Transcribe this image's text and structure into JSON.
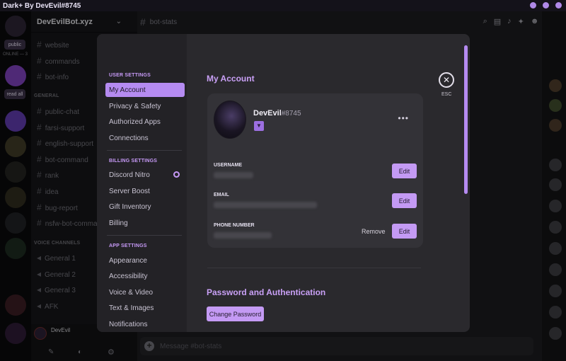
{
  "titlebar": {
    "title": "Dark+ By DevEvil#8745"
  },
  "rail": {
    "pill_public": "public",
    "online_label": "ONLINE — 3",
    "pill_read_all": "read all"
  },
  "guild": {
    "name": "DevEvilBot.xyz"
  },
  "channels": {
    "top": [
      "website",
      "commands",
      "bot-info"
    ],
    "general_header": "GENERAL",
    "general": [
      "public-chat",
      "farsi-support",
      "english-support",
      "bot-command",
      "rank",
      "idea",
      "bug-report",
      "nsfw-bot-command"
    ],
    "voice_header": "VOICE CHANNELS",
    "voice": [
      "General 1",
      "General 2",
      "General 3",
      "AFK"
    ]
  },
  "userbar": {
    "name": "DevEvil"
  },
  "chat": {
    "channel": "bot-stats",
    "placeholder": "Message #bot-stats"
  },
  "settings": {
    "user_header": "USER SETTINGS",
    "user_items": [
      "My Account",
      "Privacy & Safety",
      "Authorized Apps",
      "Connections"
    ],
    "billing_header": "BILLING SETTINGS",
    "billing_items": [
      "Discord Nitro",
      "Server Boost",
      "Gift Inventory",
      "Billing"
    ],
    "app_header": "APP SETTINGS",
    "app_items": [
      "Appearance",
      "Accessibility",
      "Voice & Video",
      "Text & Images",
      "Notifications"
    ]
  },
  "account": {
    "title": "My Account",
    "username": "DevEvil",
    "discriminator": "#8745",
    "fields": [
      {
        "label": "USERNAME",
        "action": "Edit"
      },
      {
        "label": "EMAIL",
        "action": "Edit"
      },
      {
        "label": "PHONE NUMBER",
        "action": "Edit",
        "secondary": "Remove"
      }
    ],
    "password_title": "Password and Authentication",
    "change_password": "Change Password"
  },
  "close": {
    "label": "ESC"
  },
  "colors": {
    "accent": "#c49af4",
    "active_item": "#b58bf1",
    "heading": "#c9a0f6"
  }
}
